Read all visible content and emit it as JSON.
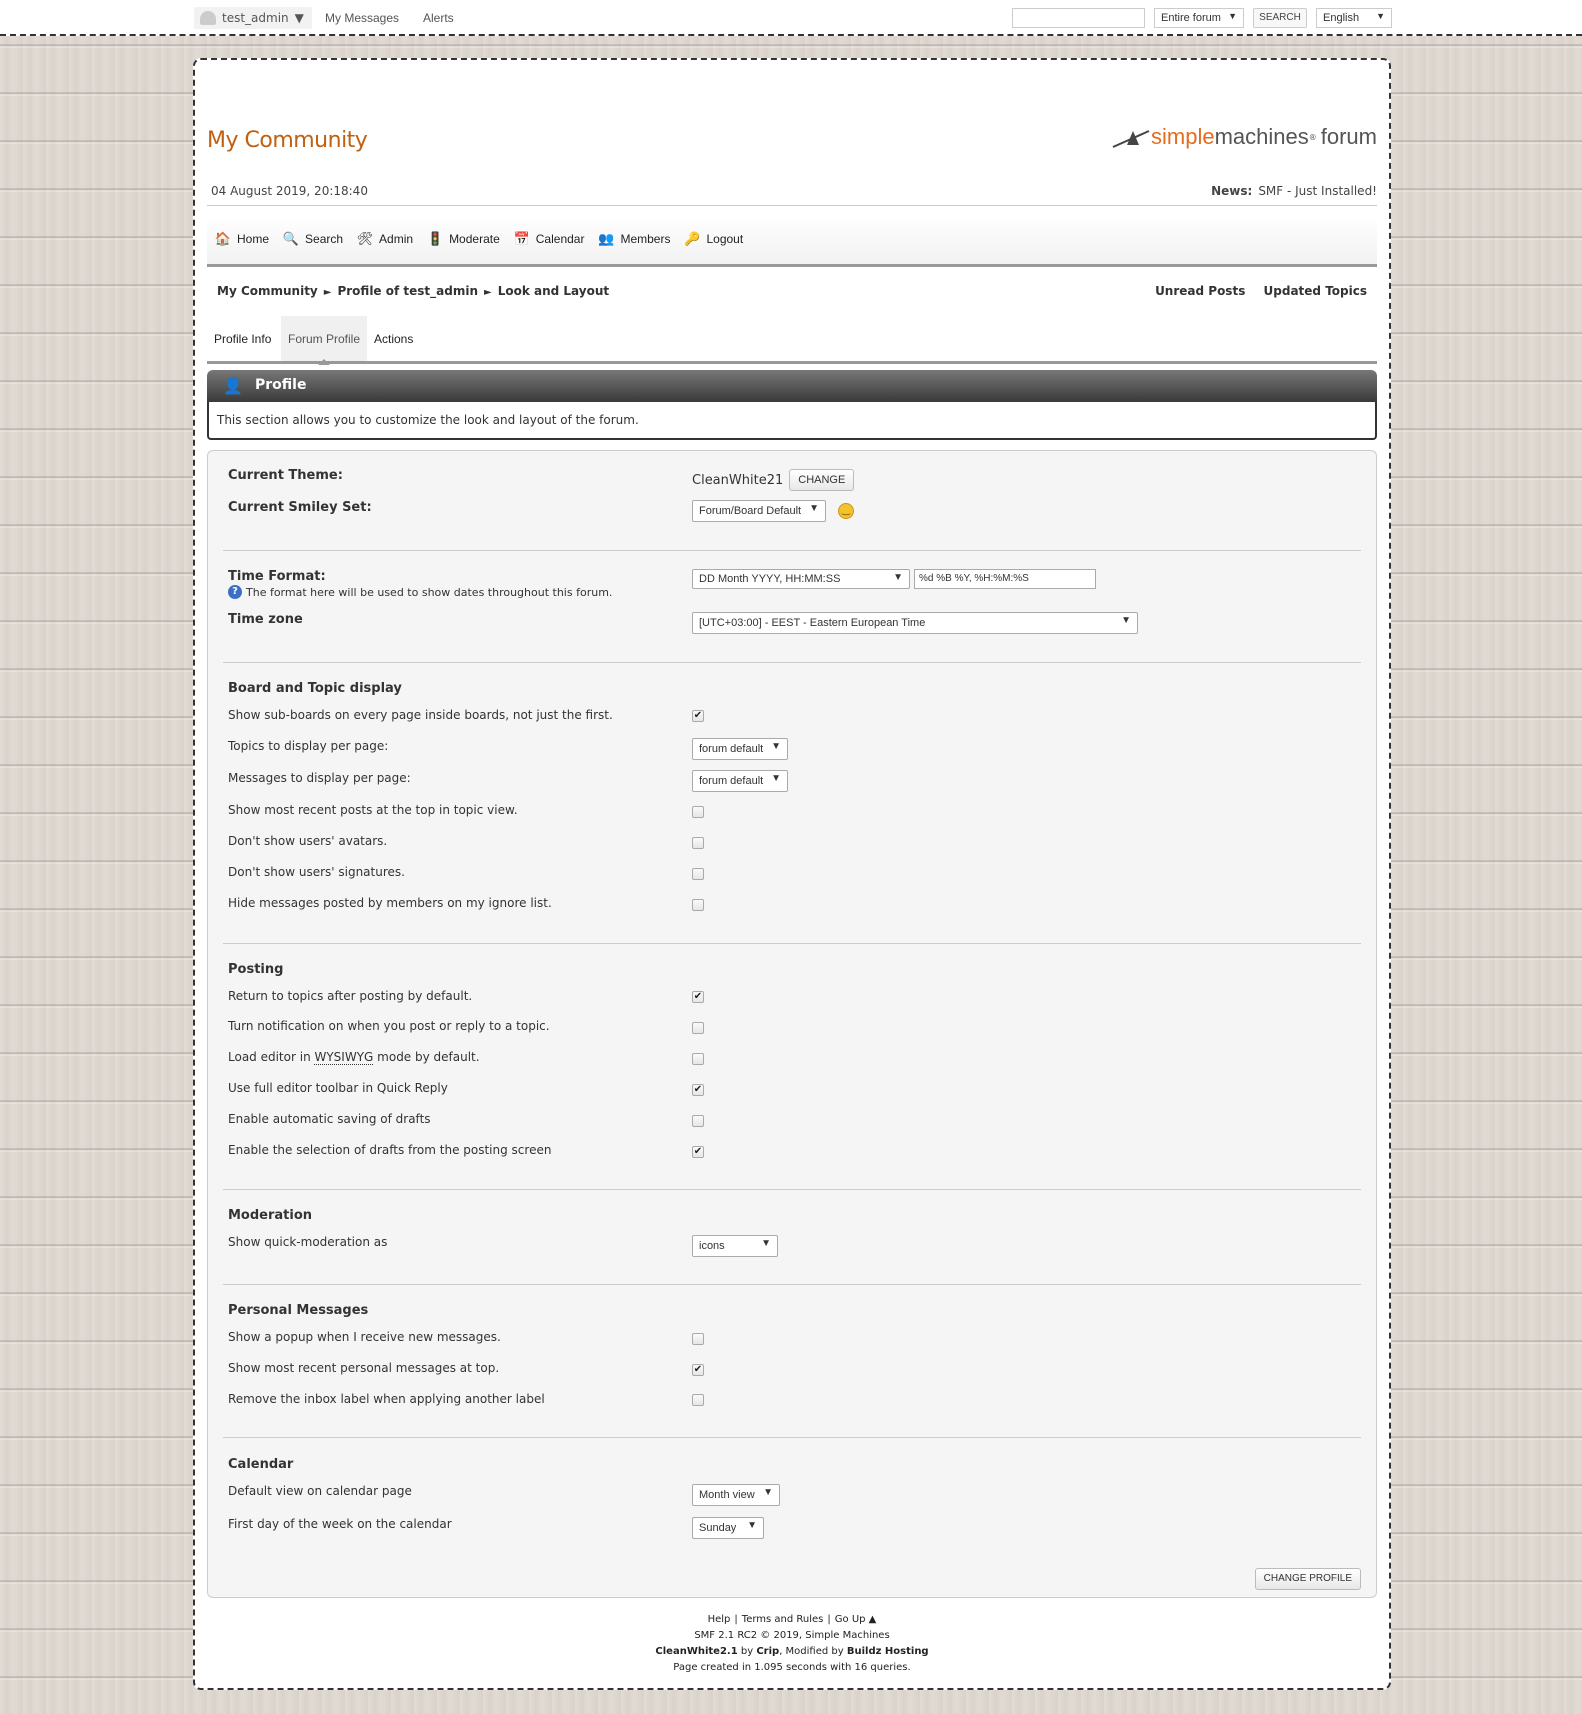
{
  "topbar": {
    "username": "test_admin",
    "user_caret": "▼",
    "my_messages": "My Messages",
    "alerts": "Alerts",
    "search_scope": "Entire forum",
    "search_button": "SEARCH",
    "language": "English"
  },
  "header": {
    "site_title": "My Community",
    "logo_simple": "simple",
    "logo_machines": "machines",
    "logo_reg": "®",
    "logo_forum": "forum",
    "date": "04 August 2019, 20:18:40",
    "news_label": "News:",
    "news_text": "SMF - Just Installed!"
  },
  "menu": {
    "items": [
      {
        "label": "Home",
        "icon": "🏠"
      },
      {
        "label": "Search",
        "icon": "🔍"
      },
      {
        "label": "Admin",
        "icon": "🛠"
      },
      {
        "label": "Moderate",
        "icon": "🚦"
      },
      {
        "label": "Calendar",
        "icon": "📅"
      },
      {
        "label": "Members",
        "icon": "👥"
      },
      {
        "label": "Logout",
        "icon": "🔑"
      }
    ]
  },
  "breadcrumb": {
    "items": [
      "My Community",
      "Profile of test_admin",
      "Look and Layout"
    ],
    "sep": "►",
    "unread_posts": "Unread Posts",
    "updated_topics": "Updated Topics"
  },
  "tabs": [
    "Profile Info",
    "Forum Profile",
    "Actions"
  ],
  "section": {
    "title": "Profile",
    "description": "This section allows you to customize the look and layout of the forum."
  },
  "settings": {
    "current_theme_label": "Current Theme:",
    "current_theme_value": "CleanWhite21",
    "change_button": "CHANGE",
    "smiley_label": "Current Smiley Set:",
    "smiley_value": "Forum/Board Default",
    "time_format_label": "Time Format:",
    "time_format_help": "The format here will be used to show dates throughout this forum.",
    "time_format_select": "DD Month YYYY, HH:MM:SS",
    "time_format_text": "%d %B %Y, %H:%M:%S",
    "timezone_label": "Time zone",
    "timezone_value": "[UTC+03:00] - EEST - Eastern European Time",
    "board_topic_heading": "Board and Topic display",
    "board_rows": [
      {
        "label": "Show sub-boards on every page inside boards, not just the first.",
        "checked": true
      },
      {
        "label": "Topics to display per page:",
        "select": "forum default"
      },
      {
        "label": "Messages to display per page:",
        "select": "forum default"
      },
      {
        "label": "Show most recent posts at the top in topic view.",
        "checked": false
      },
      {
        "label": "Don't show users' avatars.",
        "checked": false
      },
      {
        "label": "Don't show users' signatures.",
        "checked": false
      },
      {
        "label": "Hide messages posted by members on my ignore list.",
        "checked": false
      }
    ],
    "posting_heading": "Posting",
    "posting_rows": [
      {
        "label": "Return to topics after posting by default.",
        "checked": true
      },
      {
        "label": "Turn notification on when you post or reply to a topic.",
        "checked": false
      },
      {
        "label_pre": "Load editor in ",
        "label_abbr": "WYSIWYG",
        "label_post": " mode by default.",
        "checked": false
      },
      {
        "label": "Use full editor toolbar in Quick Reply",
        "checked": true
      },
      {
        "label": "Enable automatic saving of drafts",
        "checked": false
      },
      {
        "label": "Enable the selection of drafts from the posting screen",
        "checked": true
      }
    ],
    "moderation_heading": "Moderation",
    "moderation_label": "Show quick-moderation as",
    "moderation_value": "icons",
    "pm_heading": "Personal Messages",
    "pm_rows": [
      {
        "label": "Show a popup when I receive new messages.",
        "checked": false
      },
      {
        "label": "Show most recent personal messages at top.",
        "checked": true
      },
      {
        "label": "Remove the inbox label when applying another label",
        "checked": false
      }
    ],
    "calendar_heading": "Calendar",
    "calendar_default_label": "Default view on calendar page",
    "calendar_default_value": "Month view",
    "calendar_first_day_label": "First day of the week on the calendar",
    "calendar_first_day_value": "Sunday",
    "change_profile_button": "CHANGE PROFILE"
  },
  "footer": {
    "help": "Help",
    "terms": "Terms and Rules",
    "go_up": "Go Up ▲",
    "copyright": "SMF 2.1 RC2 © 2019, Simple Machines",
    "theme_credit_name": "CleanWhite2.1",
    "theme_credit_by": "by",
    "theme_credit_author": "Crip",
    "theme_credit_mod": ", Modified by",
    "theme_credit_host": "Buildz Hosting",
    "page_created": "Page created in 1.095 seconds with 16 queries."
  }
}
